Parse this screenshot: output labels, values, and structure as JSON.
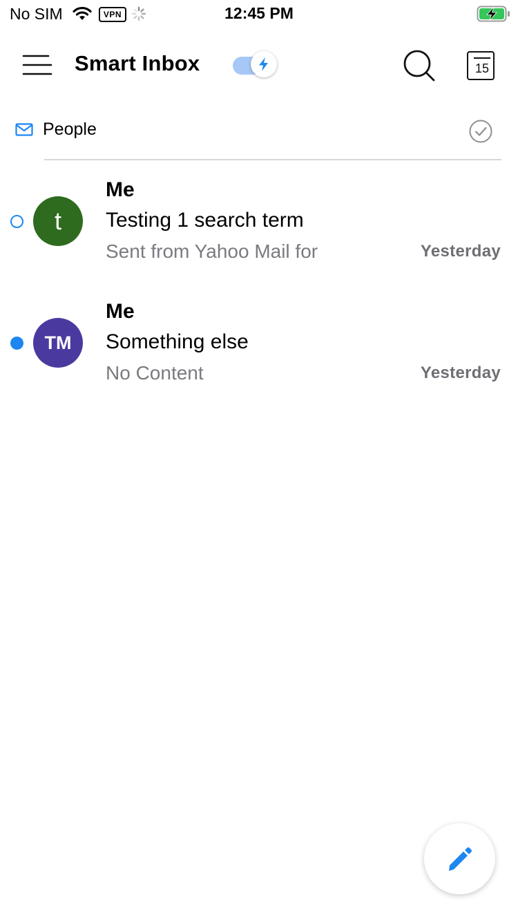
{
  "status_bar": {
    "carrier": "No SIM",
    "vpn_label": "VPN",
    "time": "12:45 PM",
    "icons": [
      "wifi-icon",
      "vpn-icon",
      "activity-spinner-icon",
      "battery-charging-icon"
    ]
  },
  "header": {
    "title": "Smart Inbox",
    "menu_icon": "hamburger-menu-icon",
    "toggle_icon": "lightning-bolt-icon",
    "toggle_on": true,
    "search_icon": "search-icon",
    "calendar_day": "15"
  },
  "section": {
    "icon": "envelope-icon",
    "title": "People",
    "action_icon": "check-circle-icon"
  },
  "messages": [
    {
      "sender": "Me",
      "subject": "Testing 1 search term",
      "snippet": "Sent from Yahoo Mail for",
      "date": "Yesterday",
      "avatar_text": "t",
      "avatar_color": "#2e6b1e",
      "unread": false
    },
    {
      "sender": "Me",
      "subject": "Something else",
      "snippet": "No Content",
      "date": "Yesterday",
      "avatar_text": "TM",
      "avatar_color": "#4a3aa0",
      "unread": true
    }
  ],
  "compose": {
    "icon": "pencil-icon"
  },
  "colors": {
    "accent": "#1d86f0",
    "toggle_track": "#a7c8f7",
    "secondary_text": "#7a7a80",
    "divider": "#d8d8dc"
  }
}
